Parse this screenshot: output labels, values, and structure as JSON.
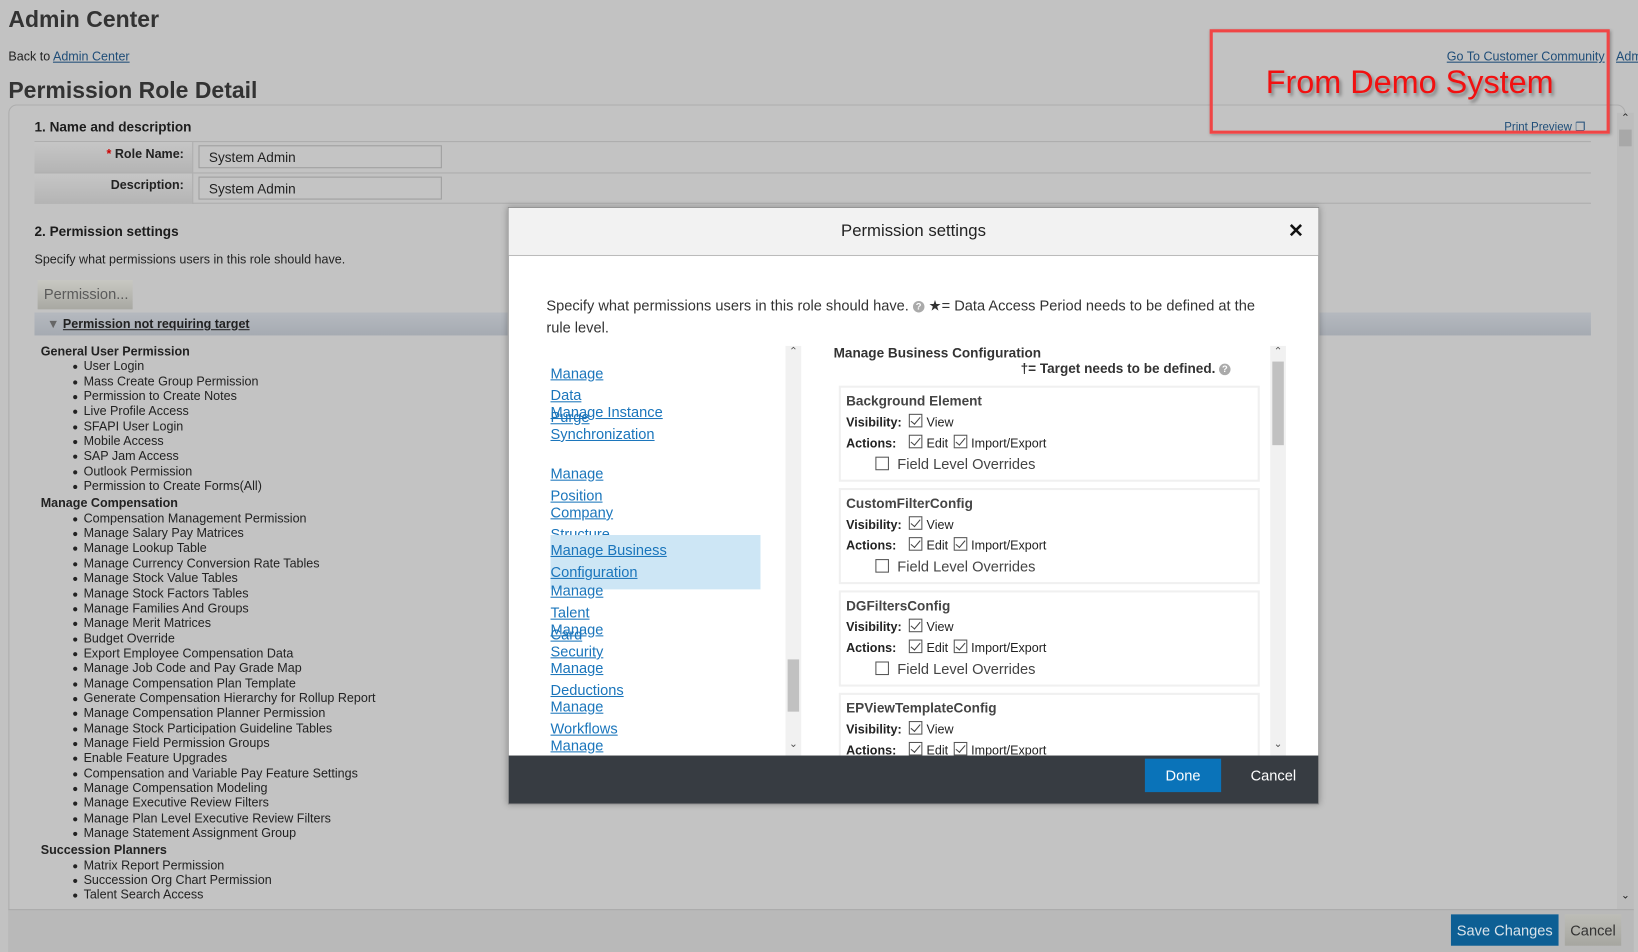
{
  "header": {
    "app_title": "Admin Center",
    "back_prefix": "Back to ",
    "back_link": "Admin Center",
    "top_links": [
      "Go To Customer Community",
      "Adm"
    ],
    "page_title": "Permission Role Detail",
    "print_preview": "Print Preview"
  },
  "annotation": {
    "text": "From Demo System",
    "color": "#f21010"
  },
  "name_section": {
    "title": "1. Name and description",
    "required_mark": "*",
    "role_name_label": "Role Name:",
    "role_name_value": "System Admin",
    "description_label": "Description:",
    "description_value": "System Admin"
  },
  "perm_section": {
    "title": "2. Permission settings",
    "description": "Specify what permissions users in this role should have.",
    "permission_button": "Permission...",
    "collapse_header": "Permission not requiring target",
    "groups": [
      {
        "name": "General User Permission",
        "items": [
          "User Login",
          "Mass Create Group Permission",
          "Permission to Create Notes",
          "Live Profile Access",
          "SFAPI User Login",
          "Mobile Access",
          "SAP Jam Access",
          "Outlook Permission",
          "Permission to Create Forms(All)"
        ]
      },
      {
        "name": "Manage Compensation",
        "items": [
          "Compensation Management Permission",
          "Manage Salary Pay Matrices",
          "Manage Lookup Table",
          "Manage Currency Conversion Rate Tables",
          "Manage Stock Value Tables",
          "Manage Stock Factors Tables",
          "Manage Families And Groups",
          "Manage Merit Matrices",
          "Budget Override",
          "Export Employee Compensation Data",
          "Manage Job Code and Pay Grade Map",
          "Manage Compensation Plan Template",
          "Generate Compensation Hierarchy for Rollup Report",
          "Manage Compensation Planner Permission",
          "Manage Stock Participation Guideline Tables",
          "Manage Field Permission Groups",
          "Enable Feature Upgrades",
          "Compensation and Variable Pay Feature Settings",
          "Manage Compensation Modeling",
          "Manage Executive Review Filters",
          "Manage Plan Level Executive Review Filters",
          "Manage Statement Assignment Group"
        ]
      },
      {
        "name": "Succession Planners",
        "items": [
          "Matrix Report Permission",
          "Succession Org Chart Permission",
          "Talent Search Access"
        ]
      }
    ]
  },
  "footer": {
    "save": "Save Changes",
    "cancel": "Cancel"
  },
  "modal": {
    "title": "Permission settings",
    "close": "X",
    "intro": "Specify what permissions users in this role should have.",
    "intro_note": "★= Data Access Period needs to be defined at the rule level.",
    "nav": [
      "Manage Data Purge",
      "Manage Instance Synchronization",
      "Manage Position",
      "Company Structure Overview",
      "Manage Business Configuration",
      "Manage Talent Card",
      "Manage Security",
      "Manage Deductions",
      "Manage Workflows",
      "Manage Action Search"
    ],
    "selected_nav": "Manage Business Configuration",
    "section_title": "Manage Business Configuration",
    "target_note": "†= Target needs to be defined.",
    "labels": {
      "visibility": "Visibility:",
      "actions": "Actions:",
      "view": "View",
      "edit": "Edit",
      "import_export": "Import/Export",
      "field_overrides": "Field Level Overrides"
    },
    "cards": [
      {
        "name": "Background Element",
        "view": true,
        "edit": true,
        "import_export": true,
        "field_overrides": false
      },
      {
        "name": "CustomFilterConfig",
        "view": true,
        "edit": true,
        "import_export": true,
        "field_overrides": false
      },
      {
        "name": "DGFiltersConfig",
        "view": true,
        "edit": true,
        "import_export": true,
        "field_overrides": false
      },
      {
        "name": "EPViewTemplateConfig",
        "view": true,
        "edit": true,
        "import_export": true,
        "field_overrides": false
      }
    ],
    "done": "Done",
    "cancel": "Cancel",
    "accent": "#0a73b9"
  }
}
